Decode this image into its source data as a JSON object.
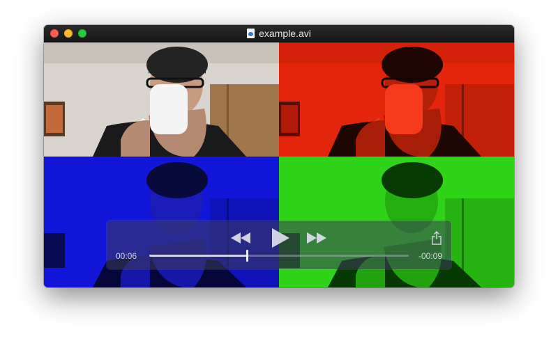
{
  "window": {
    "title": "example.avi"
  },
  "player": {
    "elapsed": "00:06",
    "remaining": "-00:09",
    "progress_fraction": 0.375
  }
}
